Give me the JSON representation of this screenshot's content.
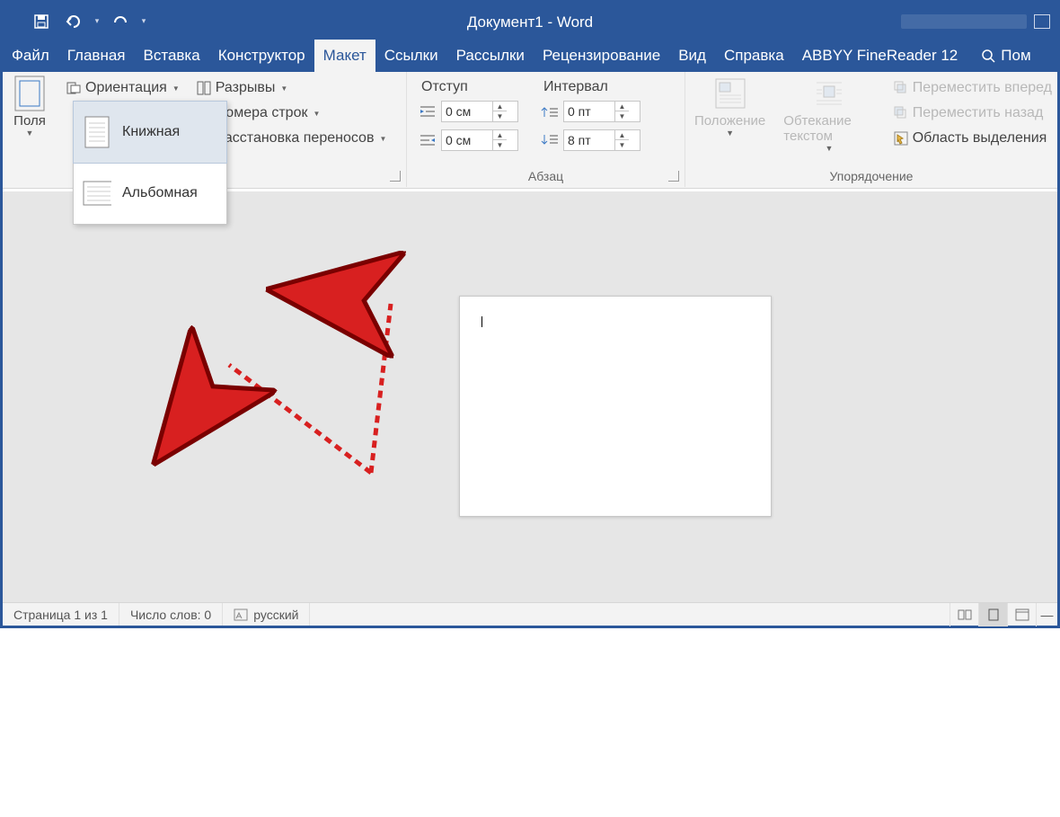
{
  "title": "Документ1  -  Word",
  "qat": {
    "save": "save",
    "undo": "undo",
    "redo": "redo"
  },
  "tabs": [
    "Файл",
    "Главная",
    "Вставка",
    "Конструктор",
    "Макет",
    "Ссылки",
    "Рассылки",
    "Рецензирование",
    "Вид",
    "Справка",
    "ABBYY FineReader 12"
  ],
  "active_tab_index": 4,
  "tellme": "Пом",
  "ribbon": {
    "margins_label": "Поля",
    "orientation_label": "Ориентация",
    "breaks_label": "Разрывы",
    "line_numbers_label": "Номера строк",
    "hyphenation_label": "Расстановка переносов",
    "indent_header": "Отступ",
    "spacing_header": "Интервал",
    "indent_left": "0 см",
    "indent_right": "0 см",
    "spacing_before": "0 пт",
    "spacing_after": "8 пт",
    "paragraph_group": "Абзац",
    "position_label": "Положение",
    "wrap_label": "Обтекание текстом",
    "bring_forward": "Переместить вперед",
    "send_backward": "Переместить назад",
    "selection_pane": "Область выделения",
    "arrange_group": "Упорядочение"
  },
  "orientation_menu": {
    "portrait": "Книжная",
    "landscape": "Альбомная"
  },
  "status": {
    "page": "Страница 1 из 1",
    "words": "Число слов: 0",
    "lang": "русский"
  }
}
